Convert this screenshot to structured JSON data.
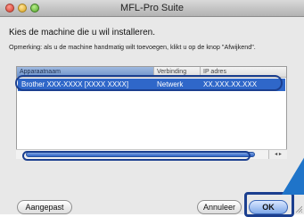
{
  "window": {
    "title": "MFL-Pro Suite"
  },
  "content": {
    "heading": "Kies de machine die u wil installeren.",
    "note": "Opmerking: als u de machine handmatig wilt toevoegen, klikt u op de knop \"Afwijkend\"."
  },
  "table": {
    "columns": [
      "Apparaatnaam",
      "Verbinding",
      "IP adres"
    ],
    "rows": [
      {
        "name": "Brother XXX-XXXX  [XXXX XXXX]",
        "connection": "Netwerk",
        "ip": "XX.XXX.XX.XXX"
      }
    ]
  },
  "buttons": {
    "custom": "Aangepast",
    "cancel": "Annuleer",
    "ok": "OK"
  },
  "scrollbar": {
    "arrows": "◂ ▸"
  },
  "colors": {
    "selection": "#2f67c9",
    "highlight_frame": "#1b3f8f"
  }
}
